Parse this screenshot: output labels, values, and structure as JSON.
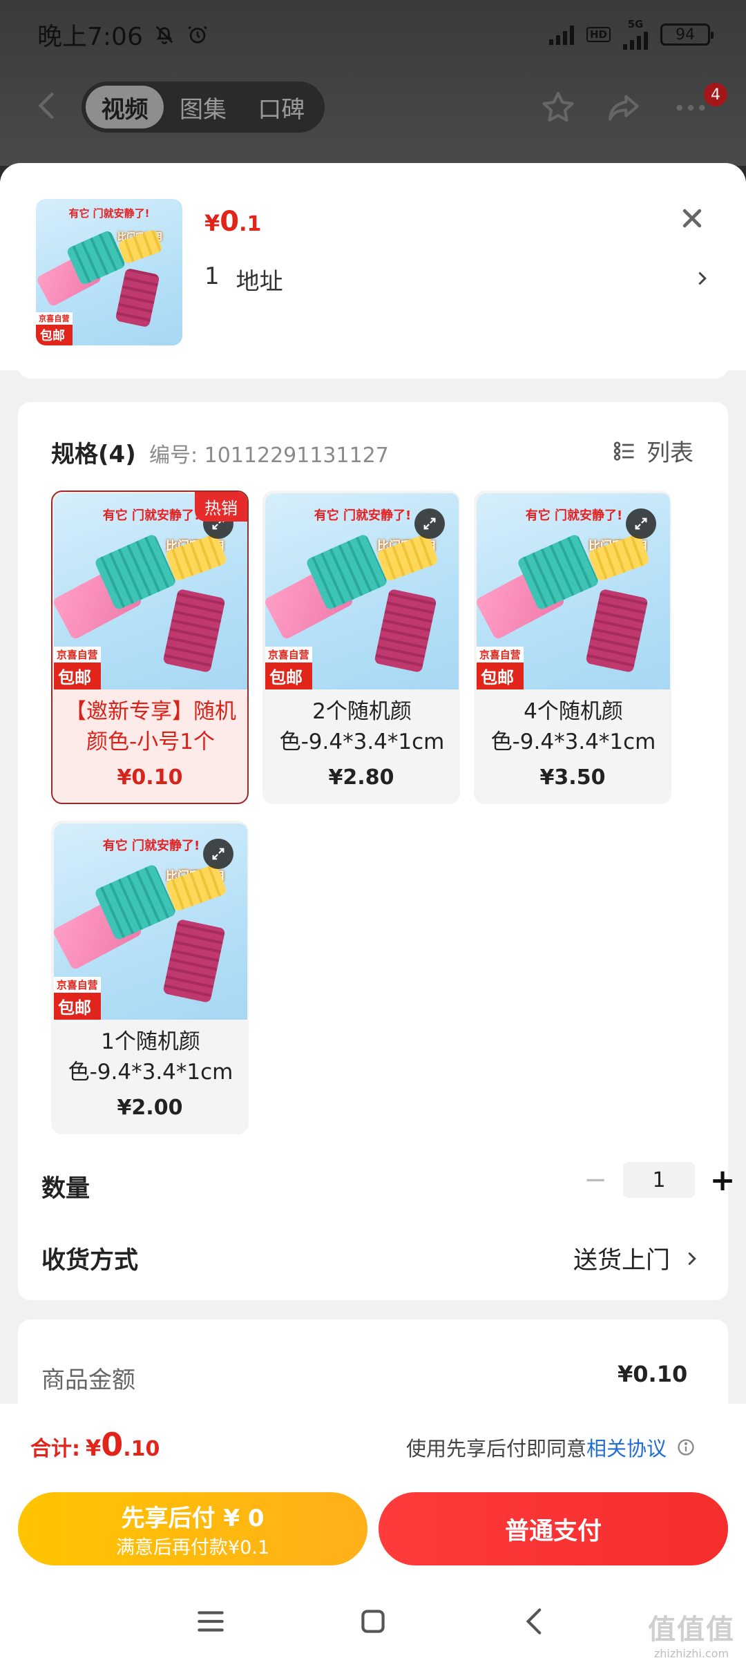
{
  "status_bar": {
    "time": "晚上7:06",
    "network": "5G",
    "hd": "HD",
    "battery": "94"
  },
  "top_nav": {
    "tabs": [
      {
        "label": "视频",
        "active": true
      },
      {
        "label": "图集",
        "active": false
      },
      {
        "label": "口碑",
        "active": false
      }
    ],
    "cart_badge": "4"
  },
  "product_header": {
    "price_currency": "¥",
    "price_int": "0",
    "price_dec": ".1",
    "quantity": "1",
    "address_label": "地址"
  },
  "product_image": {
    "headline": "有它 门就安静了!",
    "subline": "比门吸好用",
    "tag_top": "京喜自营",
    "tag_bottom": "包邮"
  },
  "spec": {
    "title": "规格(4)",
    "code": "编号: 10112291131127",
    "list_toggle": "列表",
    "hot_badge": "热销",
    "options": [
      {
        "name": "【邀新专享】随机颜色-小号1个",
        "price": "¥0.10",
        "selected": true,
        "hot": true
      },
      {
        "name": "2个随机颜色-9.4*3.4*1cm",
        "price": "¥2.80",
        "selected": false
      },
      {
        "name": "4个随机颜色-9.4*3.4*1cm",
        "price": "¥3.50",
        "selected": false
      },
      {
        "name": "1个随机颜色-9.4*3.4*1cm",
        "price": "¥2.00",
        "selected": false
      }
    ]
  },
  "quantity": {
    "label": "数量",
    "minus": "−",
    "value": "1",
    "plus": "+"
  },
  "shipping": {
    "label": "收货方式",
    "value": "送货上门"
  },
  "summary": {
    "goods_amount_label": "商品金额",
    "goods_amount_value": "¥0.10"
  },
  "footer": {
    "total_label": "合计:",
    "total_currency": "¥",
    "total_int": "0",
    "total_dec": ".10",
    "agree_prefix": "使用先享后付即同意",
    "agree_link": "相关协议",
    "pay_later_title": "先享后付 ¥ 0",
    "pay_later_sub": "满意后再付款¥0.1",
    "pay_now": "普通支付"
  },
  "watermark": {
    "logo": "值值值",
    "url": "zhizhizhi.com"
  },
  "colors": {
    "accent_red": "#e1251b",
    "link_blue": "#1f6fd6",
    "pay_later_yellow": "#ffc400",
    "pay_now_red": "#f52d2d"
  },
  "icons": [
    "back-icon",
    "star-icon",
    "share-icon",
    "more-icon",
    "close-icon",
    "chevron-right-icon",
    "list-icon",
    "expand-icon",
    "info-icon",
    "menu-icon",
    "home-icon"
  ]
}
